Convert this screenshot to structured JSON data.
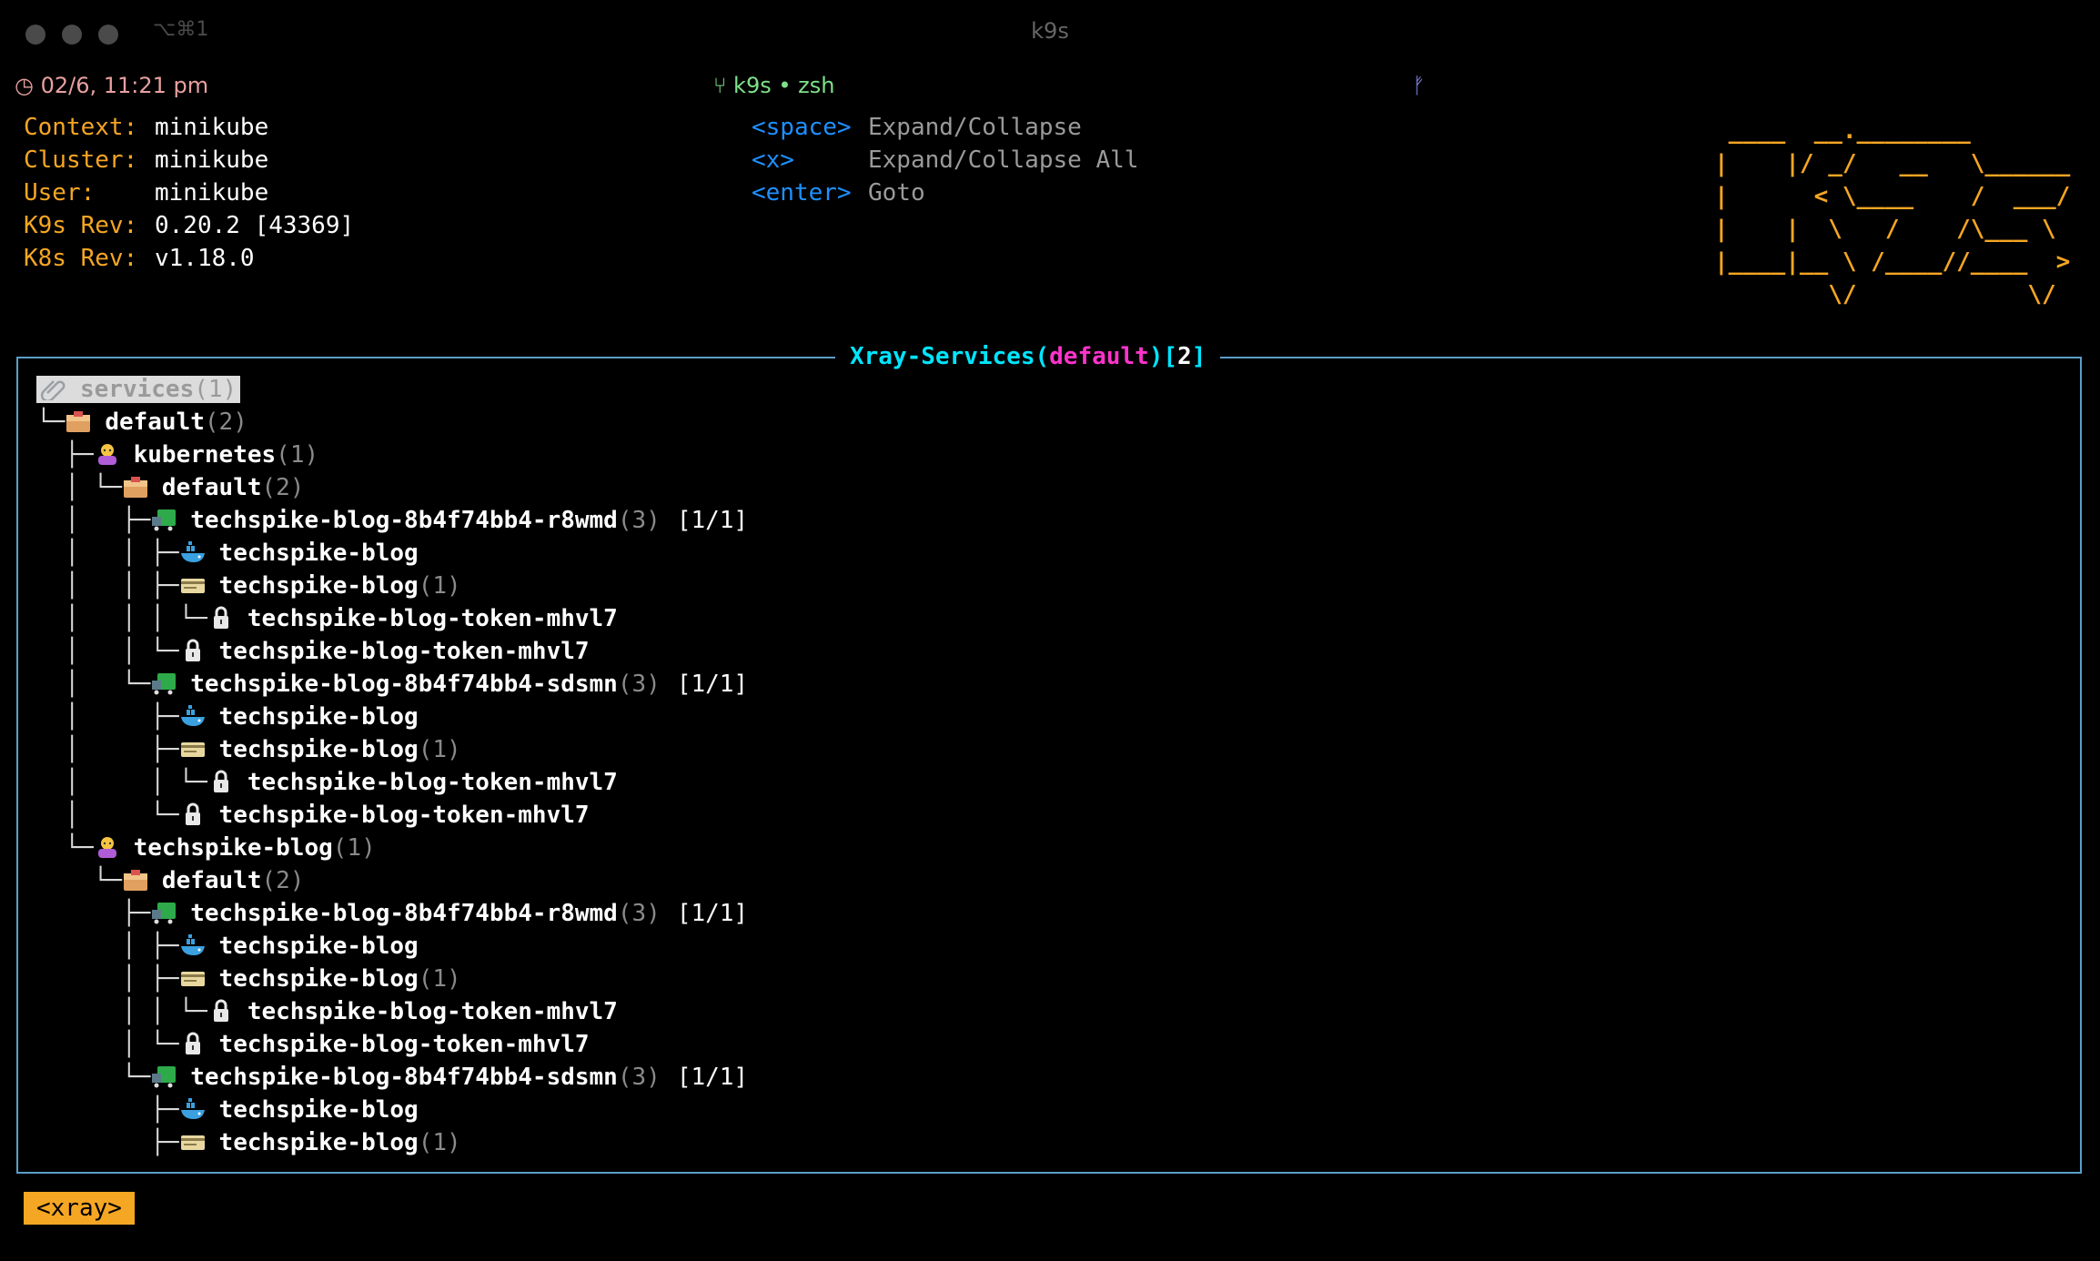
{
  "window": {
    "title": "k9s",
    "key_combo": "⌥⌘1"
  },
  "tabbar": {
    "clock": "02/6, 11:21 pm",
    "session": "k9s • zsh",
    "branch_glyph": "ᚠ"
  },
  "cluster_info": [
    {
      "label": "Context:",
      "value": "minikube"
    },
    {
      "label": "Cluster:",
      "value": "minikube"
    },
    {
      "label": "User:",
      "value": "minikube"
    },
    {
      "label": "K9s Rev:",
      "value": "0.20.2 [43369]"
    },
    {
      "label": "K8s Rev:",
      "value": "v1.18.0"
    }
  ],
  "help": [
    {
      "key": "<space>",
      "desc": "Expand/Collapse"
    },
    {
      "key": "<x>",
      "desc": "Expand/Collapse All"
    },
    {
      "key": "<enter>",
      "desc": "Goto"
    }
  ],
  "logo_ascii": " ____  __.________       \n|    |/ _/   __   \\______\n|      < \\____    /  ___/\n|    |  \\   /    /\\___ \\ \n|____|__ \\ /____//____  >\n        \\/            \\/ ",
  "panel": {
    "title_a": "Xray-Services(",
    "title_ns": "default",
    "title_b": ")[",
    "title_count": "2",
    "title_c": "]"
  },
  "colors": {
    "accent_orange": "#f5a623",
    "cyan": "#00e5ff",
    "magenta": "#ff33cc",
    "blue": "#1e90ff",
    "border": "#5a9ec8"
  },
  "tree": [
    {
      "branch": "",
      "icon": "paperclip-icon",
      "name": "services",
      "count": "(1)",
      "status": "",
      "root": true
    },
    {
      "branch": "└─",
      "icon": "namespace-icon",
      "name": "default",
      "count": "(2)",
      "status": ""
    },
    {
      "branch": "  ├─",
      "icon": "service-icon",
      "name": "kubernetes",
      "count": "(1)",
      "status": ""
    },
    {
      "branch": "  │ └─",
      "icon": "namespace-icon",
      "name": "default",
      "count": "(2)",
      "status": ""
    },
    {
      "branch": "  │   ├─",
      "icon": "pod-icon",
      "name": "techspike-blog-8b4f74bb4-r8wmd",
      "count": "(3)",
      "status": "[1/1]"
    },
    {
      "branch": "  │   │ ├─",
      "icon": "container-icon",
      "name": "techspike-blog",
      "count": "",
      "status": ""
    },
    {
      "branch": "  │   │ ├─",
      "icon": "serviceaccount-icon",
      "name": "techspike-blog",
      "count": "(1)",
      "status": ""
    },
    {
      "branch": "  │   │ │ └─",
      "icon": "secret-lock-icon",
      "name": "techspike-blog-token-mhvl7",
      "count": "",
      "status": ""
    },
    {
      "branch": "  │   │ └─",
      "icon": "secret-lock-icon",
      "name": "techspike-blog-token-mhvl7",
      "count": "",
      "status": ""
    },
    {
      "branch": "  │   └─",
      "icon": "pod-icon",
      "name": "techspike-blog-8b4f74bb4-sdsmn",
      "count": "(3)",
      "status": "[1/1]"
    },
    {
      "branch": "  │     ├─",
      "icon": "container-icon",
      "name": "techspike-blog",
      "count": "",
      "status": ""
    },
    {
      "branch": "  │     ├─",
      "icon": "serviceaccount-icon",
      "name": "techspike-blog",
      "count": "(1)",
      "status": ""
    },
    {
      "branch": "  │     │ └─",
      "icon": "secret-lock-icon",
      "name": "techspike-blog-token-mhvl7",
      "count": "",
      "status": ""
    },
    {
      "branch": "  │     └─",
      "icon": "secret-lock-icon",
      "name": "techspike-blog-token-mhvl7",
      "count": "",
      "status": ""
    },
    {
      "branch": "  └─",
      "icon": "service-icon",
      "name": "techspike-blog",
      "count": "(1)",
      "status": ""
    },
    {
      "branch": "    └─",
      "icon": "namespace-icon",
      "name": "default",
      "count": "(2)",
      "status": ""
    },
    {
      "branch": "      ├─",
      "icon": "pod-icon",
      "name": "techspike-blog-8b4f74bb4-r8wmd",
      "count": "(3)",
      "status": "[1/1]"
    },
    {
      "branch": "      │ ├─",
      "icon": "container-icon",
      "name": "techspike-blog",
      "count": "",
      "status": ""
    },
    {
      "branch": "      │ ├─",
      "icon": "serviceaccount-icon",
      "name": "techspike-blog",
      "count": "(1)",
      "status": ""
    },
    {
      "branch": "      │ │ └─",
      "icon": "secret-lock-icon",
      "name": "techspike-blog-token-mhvl7",
      "count": "",
      "status": ""
    },
    {
      "branch": "      │ └─",
      "icon": "secret-lock-icon",
      "name": "techspike-blog-token-mhvl7",
      "count": "",
      "status": ""
    },
    {
      "branch": "      └─",
      "icon": "pod-icon",
      "name": "techspike-blog-8b4f74bb4-sdsmn",
      "count": "(3)",
      "status": "[1/1]"
    },
    {
      "branch": "        ├─",
      "icon": "container-icon",
      "name": "techspike-blog",
      "count": "",
      "status": ""
    },
    {
      "branch": "        ├─",
      "icon": "serviceaccount-icon",
      "name": "techspike-blog",
      "count": "(1)",
      "status": ""
    }
  ],
  "footer": {
    "crumb": "<xray>"
  }
}
